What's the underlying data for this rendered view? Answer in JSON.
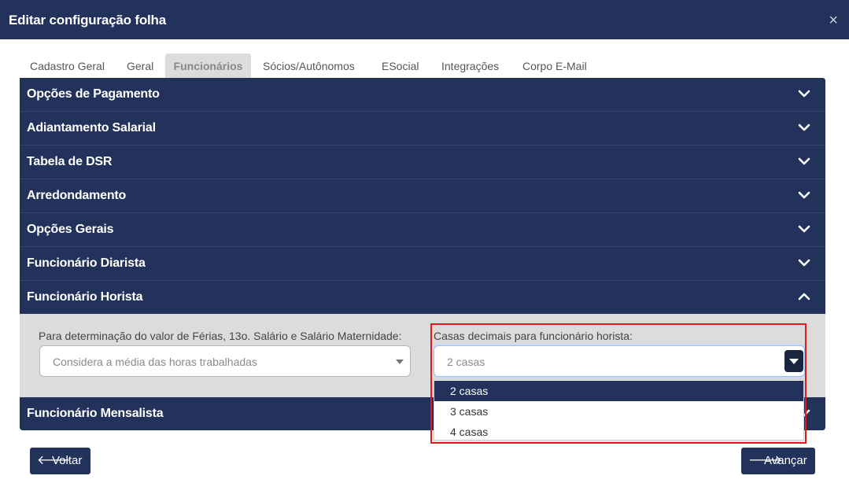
{
  "modal": {
    "title": "Editar configuração folha",
    "close_icon": "close-icon",
    "close_glyph": "×"
  },
  "tabs": [
    {
      "label": "Cadastro Geral",
      "active": false
    },
    {
      "label": "Geral",
      "active": false
    },
    {
      "label": "Funcionários",
      "active": true
    },
    {
      "label": "Sócios/Autônomos",
      "active": false
    },
    {
      "label": "ESocial",
      "active": false
    },
    {
      "label": "Integrações",
      "active": false
    },
    {
      "label": "Corpo E-Mail",
      "active": false
    }
  ],
  "accordion": {
    "sections": [
      {
        "label": "Opções de Pagamento",
        "expanded": false
      },
      {
        "label": "Adiantamento Salarial",
        "expanded": false
      },
      {
        "label": "Tabela de DSR",
        "expanded": false
      },
      {
        "label": "Arredondamento",
        "expanded": false
      },
      {
        "label": "Opções Gerais",
        "expanded": false
      },
      {
        "label": "Funcionário Diarista",
        "expanded": false
      },
      {
        "label": "Funcionário Horista",
        "expanded": true
      },
      {
        "label": "Funcionário Mensalista",
        "expanded": false
      }
    ],
    "horista": {
      "ferias_label": "Para determinação do valor de Férias, 13o. Salário e Salário Maternidade:",
      "ferias_value": "Considera a média das horas trabalhadas",
      "decimais_label": "Casas decimais para funcionário horista:",
      "decimais_value": "2 casas",
      "decimais_options": [
        "2 casas",
        "3 casas",
        "4 casas"
      ],
      "decimais_selected": "2 casas"
    }
  },
  "footer": {
    "back_label": "Voltar",
    "back_arrow": "🡐",
    "next_label": "Avançar",
    "next_arrow": "🡒"
  },
  "colors": {
    "header_bg": "#22325a",
    "accent": "#22325a",
    "panel_bg": "#dcdcdc",
    "highlight": "#e01b1b"
  }
}
